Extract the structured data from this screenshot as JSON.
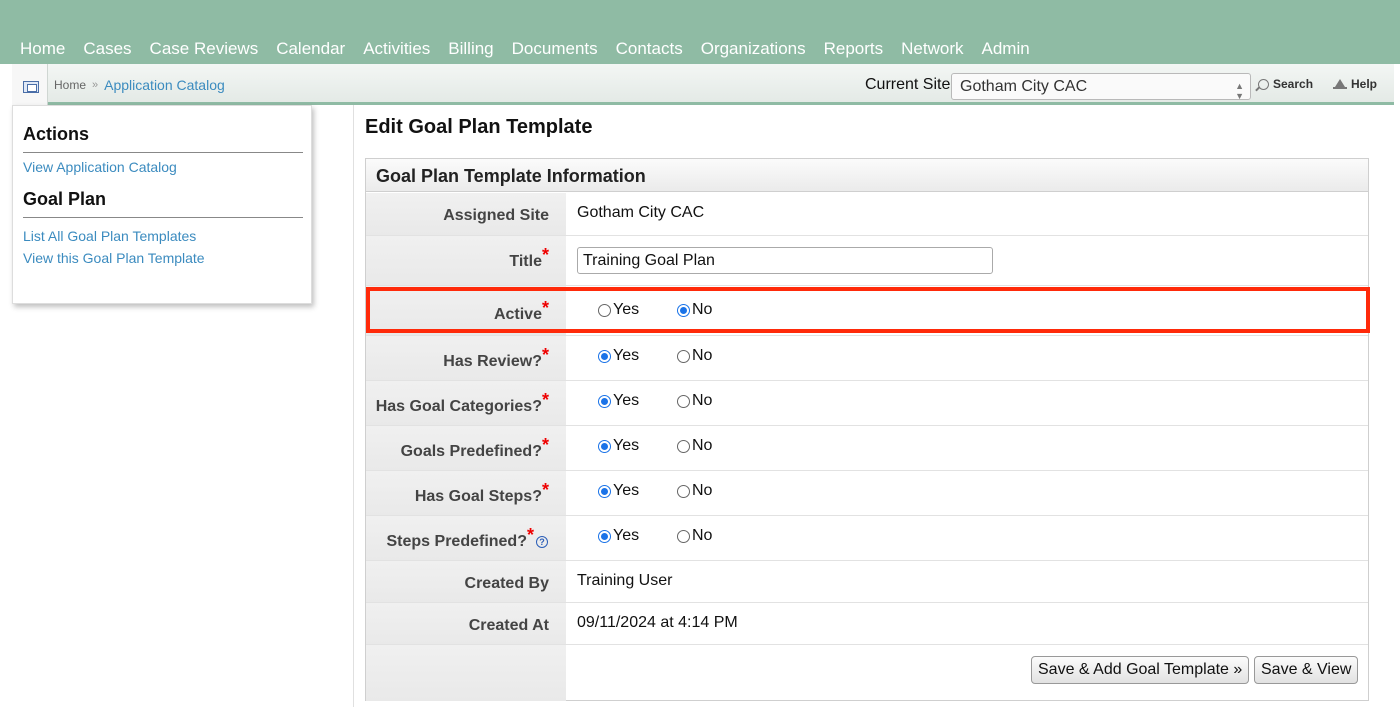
{
  "nav": {
    "items": [
      "Home",
      "Cases",
      "Case Reviews",
      "Calendar",
      "Activities",
      "Billing",
      "Documents",
      "Contacts",
      "Organizations",
      "Reports",
      "Network",
      "Admin"
    ]
  },
  "breadcrumb": {
    "home": "Home",
    "separator": "»",
    "current": "Application Catalog"
  },
  "header": {
    "site_label": "Current Site",
    "site_selected": "Gotham City CAC",
    "search_label": "Search",
    "help_label": "Help"
  },
  "sidebar": {
    "actions_heading": "Actions",
    "actions_links": [
      "View Application Catalog"
    ],
    "goal_plan_heading": "Goal Plan",
    "goal_plan_links": [
      "List All Goal Plan Templates",
      "View this Goal Plan Template"
    ]
  },
  "main": {
    "page_title": "Edit Goal Plan Template",
    "panel_title": "Goal Plan Template Information",
    "rows": [
      {
        "label": "Assigned Site",
        "value": "Gotham City CAC"
      },
      {
        "label": "Title",
        "value": "Training Goal Plan"
      },
      {
        "label": "Active",
        "selected": "No"
      },
      {
        "label": "Has Review?",
        "selected": "Yes"
      },
      {
        "label": "Has Goal Categories?",
        "selected": "Yes"
      },
      {
        "label": "Goals Predefined?",
        "selected": "Yes"
      },
      {
        "label": "Has Goal Steps?",
        "selected": "Yes"
      },
      {
        "label": "Steps Predefined?",
        "selected": "Yes"
      },
      {
        "label": "Created By",
        "value": "Training User"
      },
      {
        "label": "Created At",
        "value": "09/11/2024 at 4:14 PM"
      }
    ],
    "radio_yes": "Yes",
    "radio_no": "No",
    "required_mark": "*",
    "help_mark": "?",
    "buttons": {
      "save_add": "Save & Add Goal Template »",
      "save_view": "Save & View"
    }
  },
  "colors": {
    "topbar": "#8fbba4",
    "link": "#3b8bbf",
    "highlight": "#ff2a0a",
    "required": "#ee0000"
  },
  "icons": [
    "application-catalog-icon",
    "search-icon",
    "help-icon",
    "question-icon"
  ]
}
